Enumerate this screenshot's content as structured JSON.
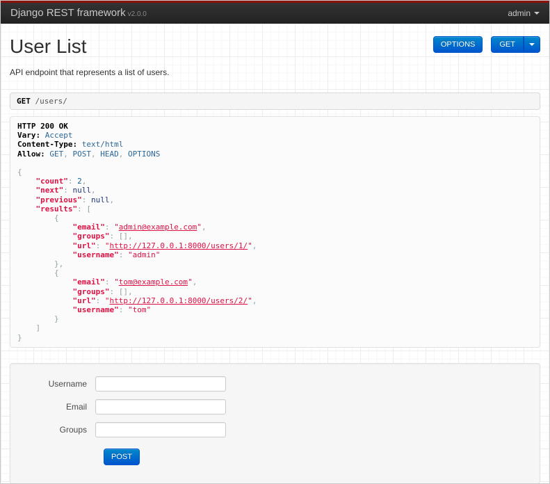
{
  "navbar": {
    "brand": "Django REST framework",
    "version": "v2.0.0",
    "user_menu": "admin"
  },
  "header": {
    "title": "User List",
    "description": "API endpoint that represents a list of users.",
    "options_button": "OPTIONS",
    "get_button": "GET"
  },
  "request": {
    "method": "GET",
    "path": "/users/"
  },
  "response": {
    "status_line": "HTTP 200 OK",
    "headers": {
      "Vary": "Accept",
      "Content-Type": "text/html",
      "Allow": "GET, POST, HEAD, OPTIONS"
    },
    "body": {
      "count": 2,
      "next": null,
      "previous": null,
      "results": [
        {
          "email": "admin@example.com",
          "groups": [],
          "url": "http://127.0.0.1:8000/users/1/",
          "username": "admin"
        },
        {
          "email": "tom@example.com",
          "groups": [],
          "url": "http://127.0.0.1:8000/users/2/",
          "username": "tom"
        }
      ]
    },
    "lines": [
      [
        {
          "c": "hdr",
          "v": "HTTP 200 OK"
        }
      ],
      [
        {
          "c": "hdr",
          "v": "Vary:"
        },
        {
          "c": "pln",
          "v": " "
        },
        {
          "c": "hval",
          "v": "Accept"
        }
      ],
      [
        {
          "c": "hdr",
          "v": "Content-Type:"
        },
        {
          "c": "pln",
          "v": " "
        },
        {
          "c": "hval",
          "v": "text/html"
        }
      ],
      [
        {
          "c": "hdr",
          "v": "Allow:"
        },
        {
          "c": "pln",
          "v": " "
        },
        {
          "c": "hval",
          "v": "GET"
        },
        {
          "c": "pun",
          "v": ", "
        },
        {
          "c": "hval",
          "v": "POST"
        },
        {
          "c": "pun",
          "v": ", "
        },
        {
          "c": "hval",
          "v": "HEAD"
        },
        {
          "c": "pun",
          "v": ", "
        },
        {
          "c": "hval",
          "v": "OPTIONS"
        }
      ],
      [],
      [
        {
          "c": "pun",
          "v": "{"
        }
      ],
      [
        {
          "c": "pln",
          "v": "    "
        },
        {
          "c": "key",
          "v": "\"count\""
        },
        {
          "c": "pun",
          "v": ": "
        },
        {
          "c": "lit",
          "v": "2"
        },
        {
          "c": "pun",
          "v": ","
        }
      ],
      [
        {
          "c": "pln",
          "v": "    "
        },
        {
          "c": "key",
          "v": "\"next\""
        },
        {
          "c": "pun",
          "v": ": "
        },
        {
          "c": "kwd",
          "v": "null"
        },
        {
          "c": "pun",
          "v": ","
        }
      ],
      [
        {
          "c": "pln",
          "v": "    "
        },
        {
          "c": "key",
          "v": "\"previous\""
        },
        {
          "c": "pun",
          "v": ": "
        },
        {
          "c": "kwd",
          "v": "null"
        },
        {
          "c": "pun",
          "v": ","
        }
      ],
      [
        {
          "c": "pln",
          "v": "    "
        },
        {
          "c": "key",
          "v": "\"results\""
        },
        {
          "c": "pun",
          "v": ": ["
        }
      ],
      [
        {
          "c": "pln",
          "v": "        "
        },
        {
          "c": "pun",
          "v": "{"
        }
      ],
      [
        {
          "c": "pln",
          "v": "            "
        },
        {
          "c": "key",
          "v": "\"email\""
        },
        {
          "c": "pun",
          "v": ": "
        },
        {
          "c": "str",
          "v": "\""
        },
        {
          "c": "lnk",
          "v": "admin@example.com",
          "link": true
        },
        {
          "c": "str",
          "v": "\""
        },
        {
          "c": "pun",
          "v": ","
        }
      ],
      [
        {
          "c": "pln",
          "v": "            "
        },
        {
          "c": "key",
          "v": "\"groups\""
        },
        {
          "c": "pun",
          "v": ": [],"
        }
      ],
      [
        {
          "c": "pln",
          "v": "            "
        },
        {
          "c": "key",
          "v": "\"url\""
        },
        {
          "c": "pun",
          "v": ": "
        },
        {
          "c": "str",
          "v": "\""
        },
        {
          "c": "lnk",
          "v": "http://127.0.0.1:8000/users/1/",
          "link": true
        },
        {
          "c": "str",
          "v": "\""
        },
        {
          "c": "pun",
          "v": ","
        }
      ],
      [
        {
          "c": "pln",
          "v": "            "
        },
        {
          "c": "key",
          "v": "\"username\""
        },
        {
          "c": "pun",
          "v": ": "
        },
        {
          "c": "str",
          "v": "\"admin\""
        }
      ],
      [
        {
          "c": "pln",
          "v": "        "
        },
        {
          "c": "pun",
          "v": "},"
        }
      ],
      [
        {
          "c": "pln",
          "v": "        "
        },
        {
          "c": "pun",
          "v": "{"
        }
      ],
      [
        {
          "c": "pln",
          "v": "            "
        },
        {
          "c": "key",
          "v": "\"email\""
        },
        {
          "c": "pun",
          "v": ": "
        },
        {
          "c": "str",
          "v": "\""
        },
        {
          "c": "lnk",
          "v": "tom@example.com",
          "link": true
        },
        {
          "c": "str",
          "v": "\""
        },
        {
          "c": "pun",
          "v": ","
        }
      ],
      [
        {
          "c": "pln",
          "v": "            "
        },
        {
          "c": "key",
          "v": "\"groups\""
        },
        {
          "c": "pun",
          "v": ": [],"
        }
      ],
      [
        {
          "c": "pln",
          "v": "            "
        },
        {
          "c": "key",
          "v": "\"url\""
        },
        {
          "c": "pun",
          "v": ": "
        },
        {
          "c": "str",
          "v": "\""
        },
        {
          "c": "lnk",
          "v": "http://127.0.0.1:8000/users/2/",
          "link": true
        },
        {
          "c": "str",
          "v": "\""
        },
        {
          "c": "pun",
          "v": ","
        }
      ],
      [
        {
          "c": "pln",
          "v": "            "
        },
        {
          "c": "key",
          "v": "\"username\""
        },
        {
          "c": "pun",
          "v": ": "
        },
        {
          "c": "str",
          "v": "\"tom\""
        }
      ],
      [
        {
          "c": "pln",
          "v": "        "
        },
        {
          "c": "pun",
          "v": "}"
        }
      ],
      [
        {
          "c": "pln",
          "v": "    "
        },
        {
          "c": "pun",
          "v": "]"
        }
      ],
      [
        {
          "c": "pun",
          "v": "}"
        }
      ]
    ]
  },
  "form": {
    "fields": [
      {
        "label": "Username",
        "value": ""
      },
      {
        "label": "Email",
        "value": ""
      },
      {
        "label": "Groups",
        "value": ""
      }
    ],
    "submit_label": "POST"
  },
  "colors": {
    "navbar_stripe": "#8a120b",
    "navbar_bg": "#2c2c2c",
    "button_blue_top": "#0088cc",
    "button_blue_bottom": "#0055cc",
    "json_string": "#d14",
    "json_literal": "#195f91",
    "json_keyword": "#1e347b",
    "header_value_blue": "#2b6698",
    "punctuation_gray": "#93a1a1"
  }
}
